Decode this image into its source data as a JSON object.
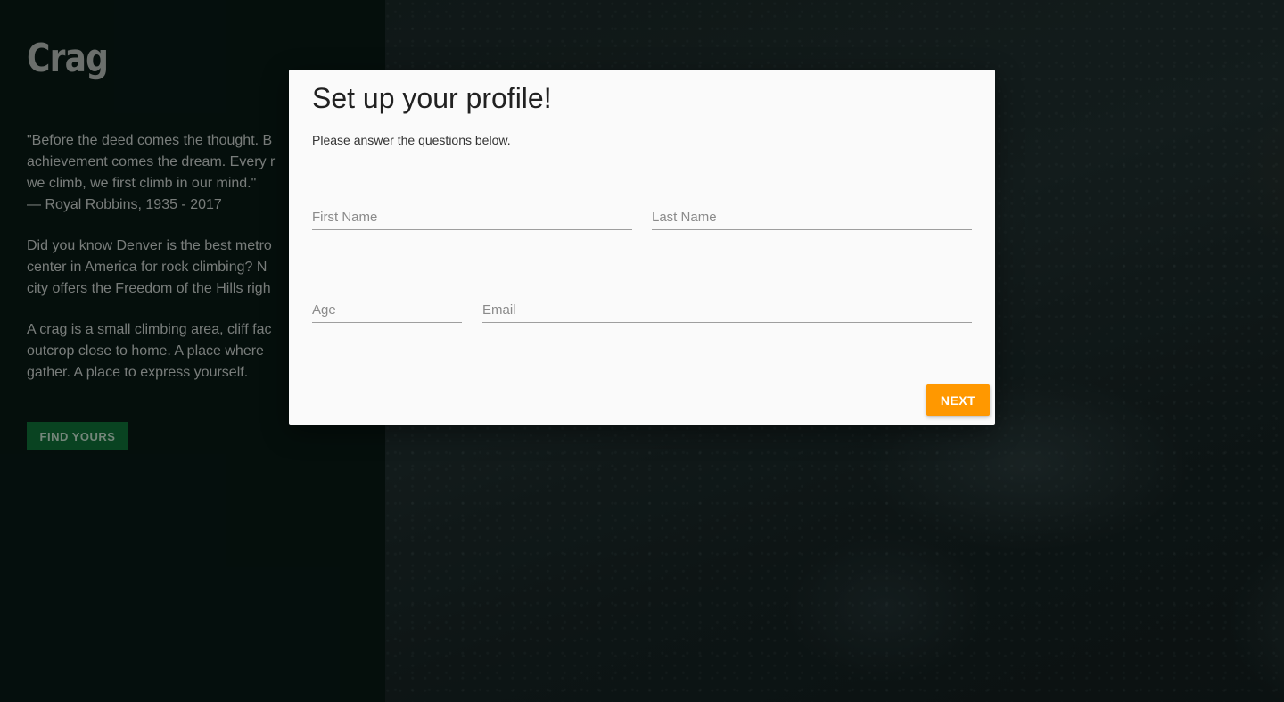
{
  "page": {
    "brand": "Crag",
    "quote": "\"Before the deed comes the thought. B\nachievement comes the dream. Every r\nwe climb, we first climb in our mind.\"\n— Royal Robbins, 1935 - 2017",
    "para1": "Did you know Denver is the best metro\ncenter in America for rock climbing? N\ncity offers the Freedom of the Hills righ",
    "para2": "A crag is a small climbing area, cliff fac\noutcrop close to home. A place where\ngather. A place to express yourself.",
    "cta_label": "FIND YOURS",
    "cta_color": "#0c5a2c"
  },
  "modal": {
    "title": "Set up your profile!",
    "subtitle": "Please answer the questions below.",
    "fields": {
      "first_name": {
        "placeholder": "First Name",
        "value": ""
      },
      "last_name": {
        "placeholder": "Last Name",
        "value": ""
      },
      "age": {
        "placeholder": "Age",
        "value": ""
      },
      "email": {
        "placeholder": "Email",
        "value": ""
      }
    },
    "next_label": "NEXT",
    "next_color": "#ff9800"
  }
}
